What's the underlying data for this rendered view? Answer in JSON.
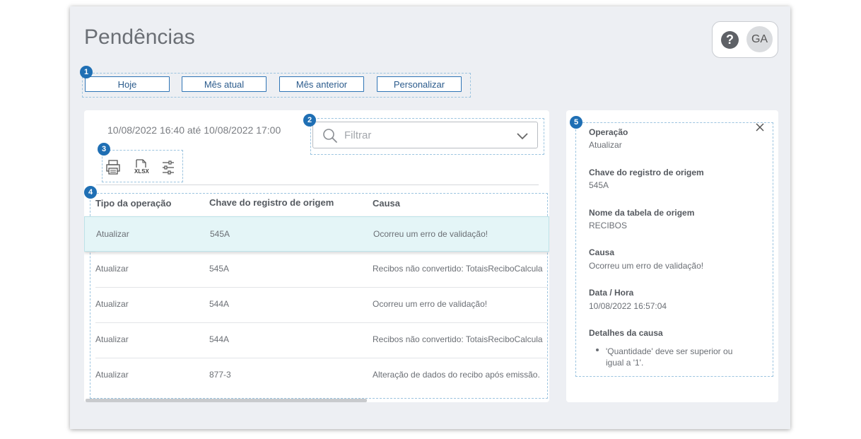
{
  "page": {
    "title": "Pendências"
  },
  "header": {
    "help_glyph": "?",
    "avatar_initials": "GA"
  },
  "badges": [
    "1",
    "2",
    "3",
    "4",
    "5"
  ],
  "period_buttons": [
    "Hoje",
    "Mês atual",
    "Mês anterior",
    "Personalizar"
  ],
  "main": {
    "date_range": "10/08/2022 16:40 até 10/08/2022 17:00",
    "filter": {
      "placeholder": "Filtrar"
    },
    "toolbar": {
      "xlsx_label": "XLSX",
      "icons": [
        "print-icon",
        "xlsx-export-icon",
        "settings-sliders-icon"
      ]
    },
    "table": {
      "columns": [
        "Tipo da operação",
        "Chave do registro de origem",
        "Causa"
      ],
      "rows": [
        {
          "op": "Atualizar",
          "key": "545A",
          "cause": "Ocorreu um erro de validação!",
          "selected": true
        },
        {
          "op": "Atualizar",
          "key": "545A",
          "cause": "Recibos não convertido: TotaisReciboCalcula"
        },
        {
          "op": "Atualizar",
          "key": "544A",
          "cause": "Ocorreu um erro de validação!"
        },
        {
          "op": "Atualizar",
          "key": "544A",
          "cause": "Recibos não convertido: TotaisReciboCalcula"
        },
        {
          "op": "Atualizar",
          "key": "877-3",
          "cause": "Alteração de dados do recibo após emissão."
        }
      ]
    }
  },
  "details": {
    "operation_label": "Operação",
    "operation_value": "Atualizar",
    "key_label": "Chave do registro de origem",
    "key_value": "545A",
    "table_label": "Nome da tabela de origem",
    "table_value": "RECIBOS",
    "cause_label": "Causa",
    "cause_value": "Ocorreu um erro de validação!",
    "datetime_label": "Data / Hora",
    "datetime_value": "10/08/2022 16:57:04",
    "cause_details_label": "Detalhes da causa",
    "cause_details_line1": "'Quantidade' deve ser superior ou",
    "cause_details_line2": "igual a '1'."
  },
  "colors": {
    "accent": "#1f6fb4",
    "button_border": "#2f74b5",
    "selected_row": "#e4f5f7"
  }
}
